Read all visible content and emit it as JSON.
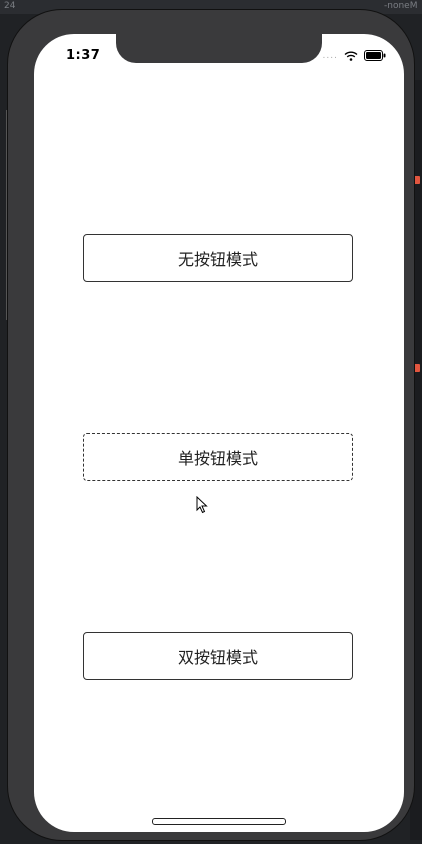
{
  "status_bar": {
    "time": "1:37",
    "signal": "....",
    "wifi_icon": "wifi-icon",
    "battery_icon": "battery-icon"
  },
  "buttons": [
    {
      "label": "无按钮模式"
    },
    {
      "label": "单按钮模式"
    },
    {
      "label": "双按钮模式"
    }
  ],
  "ide": {
    "tab_left": "24",
    "tab_right": "-noneM"
  },
  "colors": {
    "screen_bg": "#ffffff",
    "device_frame": "#3a3a3c",
    "button_border": "#333333"
  }
}
